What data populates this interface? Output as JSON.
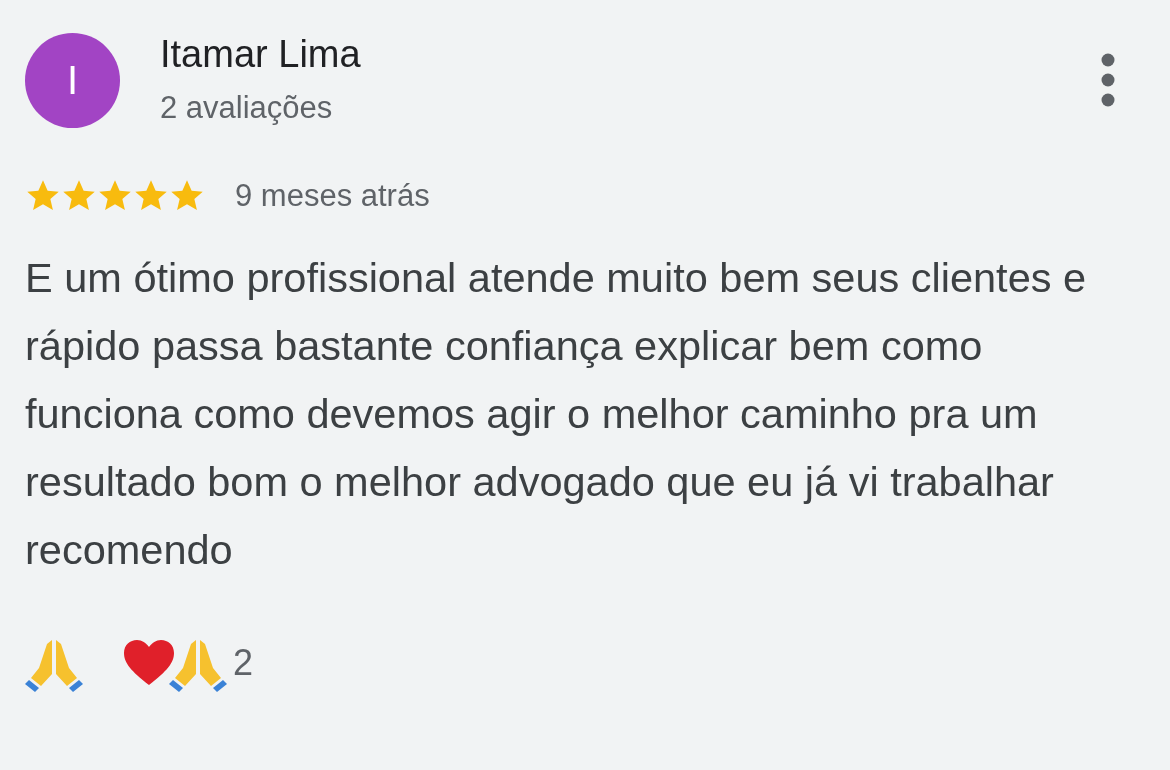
{
  "reviewer": {
    "initial": "I",
    "name": "Itamar Lima",
    "review_count": "2 avaliações"
  },
  "review": {
    "stars": 5,
    "time": "9 meses atrás",
    "text": "E um ótimo profissional atende muito bem seus clientes e rápido passa bastante confiança explicar bem como funciona como devemos agir o melhor caminho pra um resultado bom o melhor advogado que eu já vi trabalhar recomendo"
  },
  "reactions": {
    "count": "2"
  }
}
